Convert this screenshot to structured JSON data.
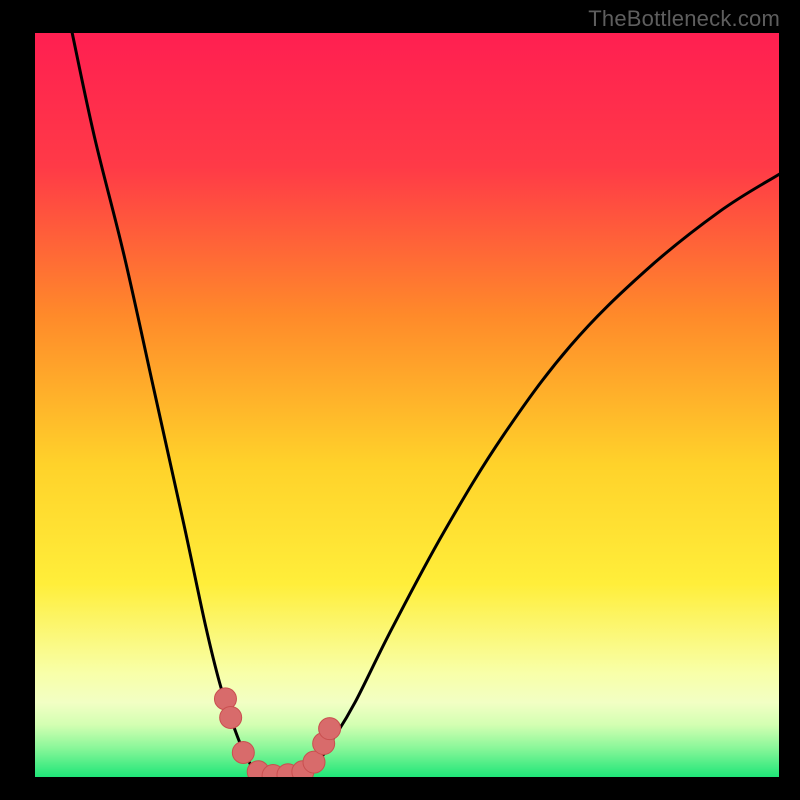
{
  "watermark": "TheBottleneck.com",
  "colors": {
    "frame": "#000000",
    "gradient_top": "#ff1f51",
    "gradient_mid_upper": "#ff7a2b",
    "gradient_mid": "#ffe82e",
    "gradient_lower": "#f6ffb9",
    "gradient_band": "#d9ffb6",
    "gradient_bottom": "#1fe678",
    "curve": "#000000",
    "marker_fill": "#d86b6b",
    "marker_stroke": "#c94f4f"
  },
  "chart_data": {
    "type": "line",
    "title": "",
    "xlabel": "",
    "ylabel": "",
    "xlim": [
      0,
      100
    ],
    "ylim": [
      0,
      100
    ],
    "series": [
      {
        "name": "bottleneck-curve",
        "x": [
          5,
          8,
          12,
          16,
          20,
          23,
          25,
          27,
          28.5,
          30,
          32,
          34,
          36,
          38,
          40,
          43,
          48,
          55,
          63,
          72,
          82,
          92,
          100
        ],
        "y": [
          100,
          86,
          70,
          52,
          34,
          20,
          12,
          6,
          2.5,
          0.6,
          0.2,
          0.2,
          0.6,
          2,
          5,
          10,
          20,
          33,
          46,
          58,
          68,
          76,
          81
        ]
      }
    ],
    "markers": {
      "name": "highlight-points",
      "x": [
        25.6,
        26.3,
        28.0,
        30.0,
        32.0,
        34.0,
        36.0,
        37.5,
        38.8,
        39.6
      ],
      "y": [
        10.5,
        8.0,
        3.3,
        0.7,
        0.2,
        0.3,
        0.7,
        2.0,
        4.5,
        6.5
      ]
    }
  }
}
